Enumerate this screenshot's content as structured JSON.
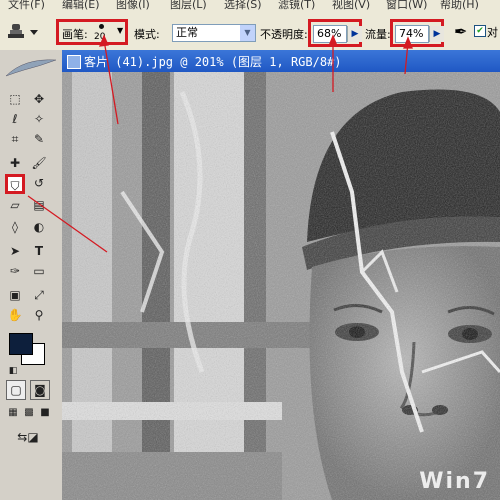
{
  "menubar": {
    "items": [
      "文件(F)",
      "编辑(E)",
      "图像(I)",
      "图层(L)",
      "选择(S)",
      "滤镜(T)",
      "视图(V)",
      "窗口(W)",
      "帮助(H)"
    ]
  },
  "options": {
    "brush_label": "画笔:",
    "brush_size": "20",
    "mode_label": "模式:",
    "mode_value": "正常",
    "opacity_label": "不透明度:",
    "opacity_value": "68%",
    "flow_label": "流量:",
    "flow_value": "74%",
    "aligned_label": "对"
  },
  "document": {
    "title": "客片 (41).jpg @ 201% (图层 1, RGB/8#)"
  },
  "watermark": "Win7",
  "colors": {
    "highlight": "#d41a22",
    "foreground": "#0d1f3c",
    "background": "#ffffff"
  }
}
